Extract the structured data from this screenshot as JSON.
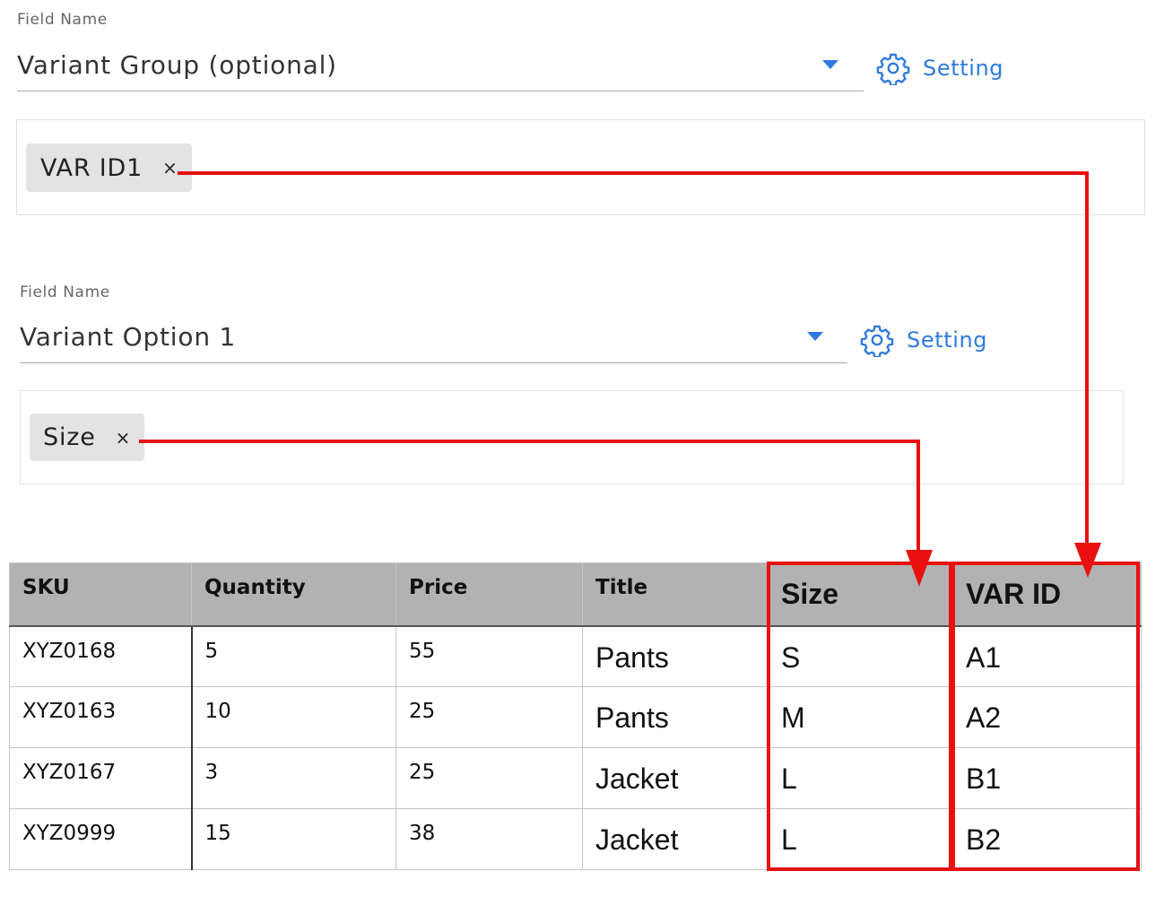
{
  "fields": [
    {
      "label": "Field Name",
      "value": "Variant Group (optional)",
      "setting_label": "Setting",
      "tags": [
        {
          "text": "VAR ID1",
          "remove": "×"
        }
      ]
    },
    {
      "label": "Field Name",
      "value": "Variant Option 1",
      "setting_label": "Setting",
      "tags": [
        {
          "text": "Size",
          "remove": "×"
        }
      ]
    }
  ],
  "table": {
    "headers": [
      "SKU",
      "Quantity",
      "Price",
      "Title",
      "Size",
      "VAR ID"
    ],
    "rows": [
      [
        "XYZ0168",
        "5",
        "55",
        "Pants",
        "S",
        "A1"
      ],
      [
        "XYZ0163",
        "10",
        "25",
        "Pants",
        "M",
        "A2"
      ],
      [
        "XYZ0167",
        "3",
        "25",
        "Jacket",
        "L",
        "B1"
      ],
      [
        "XYZ0999",
        "15",
        "38",
        "Jacket",
        "L",
        "B2"
      ]
    ]
  },
  "colors": {
    "accent": "#2f7ae0",
    "highlight": "#e81010",
    "chip_bg": "#e3e3e3",
    "header_bg": "#b2b2b2"
  },
  "icons": {
    "setting": "gear-icon",
    "dropdown": "caret-down-icon",
    "remove": "close-icon",
    "connector": "arrow-down-icon"
  }
}
